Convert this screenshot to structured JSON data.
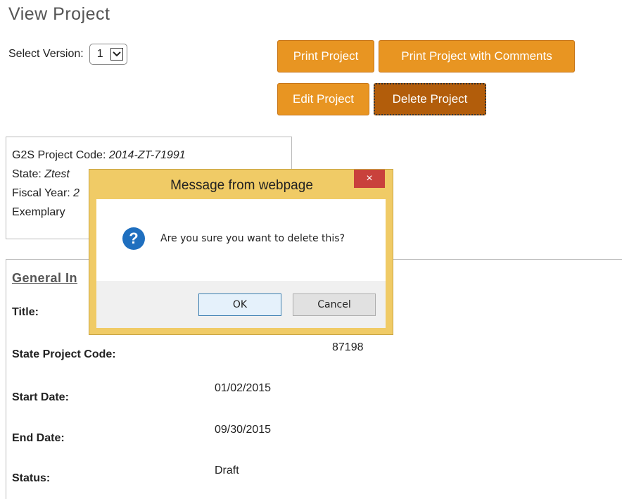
{
  "page": {
    "title": "View Project",
    "version_label": "Select Version:",
    "version_value": "1"
  },
  "buttons": {
    "print": "Print Project",
    "print_comments": "Print Project with Comments",
    "edit": "Edit Project",
    "delete": "Delete Project"
  },
  "info": {
    "code_label": "G2S Project Code: ",
    "code_value": "2014-ZT-71991",
    "state_label": "State: ",
    "state_value": "Ztest",
    "fiscal_label": "Fiscal Year: ",
    "fiscal_value": "2",
    "exemplary": "Exemplary"
  },
  "general": {
    "section_title": "General In",
    "fields": [
      {
        "label": "Title:",
        "value": ""
      },
      {
        "label": "State Project Code:",
        "value": "87198"
      },
      {
        "label": "Start Date:",
        "value": "01/02/2015"
      },
      {
        "label": "End Date:",
        "value": "09/30/2015"
      },
      {
        "label": "Status:",
        "value": "Draft"
      }
    ]
  },
  "dialog": {
    "title": "Message from webpage",
    "close": "×",
    "message": "Are you sure you want to delete this?",
    "ok": "OK",
    "cancel": "Cancel",
    "icon": "question-icon",
    "accent": "#1f6fbf"
  }
}
